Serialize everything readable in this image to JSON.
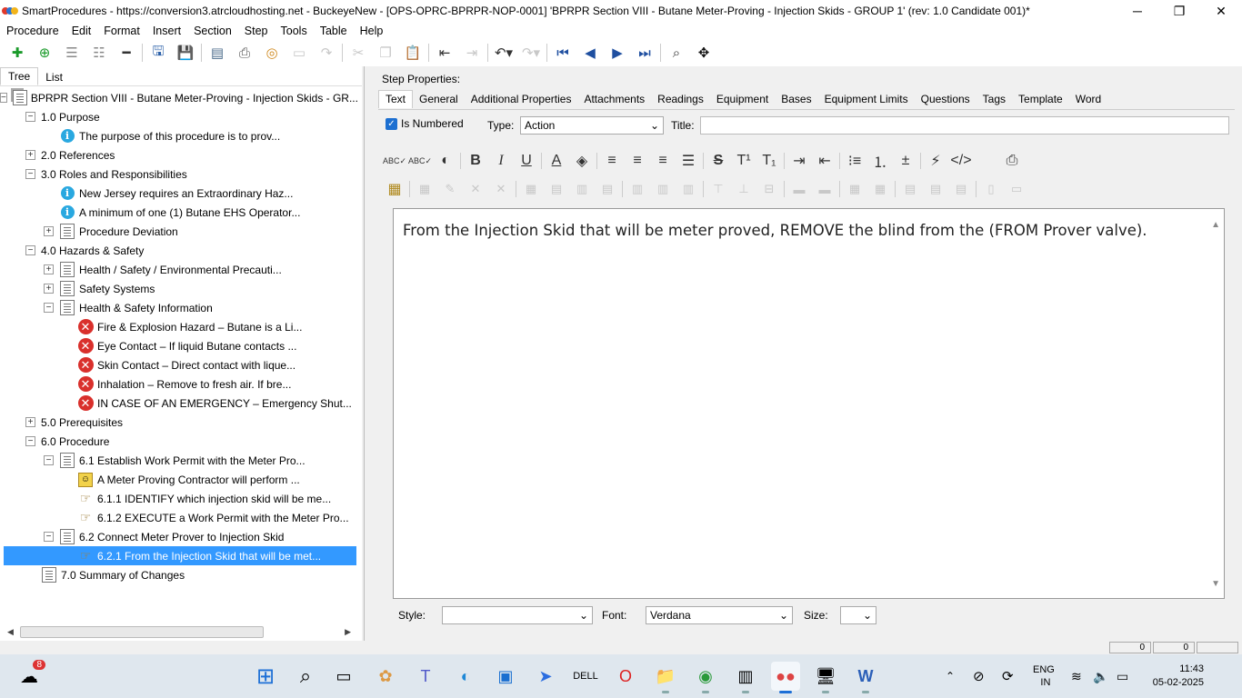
{
  "window": {
    "title": "SmartProcedures - https://conversion3.atrcloudhosting.net - BuckeyeNew - [OPS-OPRC-BPRPR-NOP-0001] 'BPRPR Section VIII - Butane Meter-Proving - Injection Skids - GROUP 1' (rev: 1.0 Candidate 001)*",
    "minimize": "─",
    "restore": "❐",
    "close": "✕"
  },
  "menu": [
    "Procedure",
    "Edit",
    "Format",
    "Insert",
    "Section",
    "Step",
    "Tools",
    "Table",
    "Help"
  ],
  "left_tabs": [
    "Tree",
    "List"
  ],
  "tree": [
    {
      "level": 0,
      "exp": "−",
      "icon": "doc-stack",
      "label": "BPRPR Section VIII - Butane Meter-Proving - Injection Skids - GR..."
    },
    {
      "level": 1,
      "exp": "−",
      "icon": "none",
      "label": "1.0 Purpose"
    },
    {
      "level": 2,
      "exp": "",
      "icon": "info",
      "label": "The purpose of this procedure is to prov..."
    },
    {
      "level": 1,
      "exp": "+",
      "icon": "none",
      "label": "2.0 References"
    },
    {
      "level": 1,
      "exp": "−",
      "icon": "none",
      "label": "3.0 Roles and Responsibilities"
    },
    {
      "level": 2,
      "exp": "",
      "icon": "info",
      "label": "New Jersey requires an Extraordinary Haz..."
    },
    {
      "level": 2,
      "exp": "",
      "icon": "info",
      "label": "A minimum of one (1) Butane EHS Operator..."
    },
    {
      "level": 2,
      "exp": "+",
      "icon": "doc",
      "label": "Procedure Deviation"
    },
    {
      "level": 1,
      "exp": "−",
      "icon": "none",
      "label": "4.0 Hazards & Safety"
    },
    {
      "level": 2,
      "exp": "+",
      "icon": "doc",
      "label": "Health / Safety / Environmental Precauti..."
    },
    {
      "level": 2,
      "exp": "+",
      "icon": "doc",
      "label": "Safety Systems"
    },
    {
      "level": 2,
      "exp": "−",
      "icon": "doc",
      "label": "Health & Safety Information"
    },
    {
      "level": 3,
      "exp": "",
      "icon": "x",
      "label": "Fire & Explosion Hazard – Butane is a Li..."
    },
    {
      "level": 3,
      "exp": "",
      "icon": "x",
      "label": "Eye Contact – If liquid Butane contacts ..."
    },
    {
      "level": 3,
      "exp": "",
      "icon": "x",
      "label": "Skin Contact – Direct contact with lique..."
    },
    {
      "level": 3,
      "exp": "",
      "icon": "x",
      "label": "Inhalation – Remove to fresh air. If bre..."
    },
    {
      "level": 3,
      "exp": "",
      "icon": "x",
      "label": "IN CASE OF AN EMERGENCY – Emergency Shut..."
    },
    {
      "level": 1,
      "exp": "+",
      "icon": "none",
      "label": "5.0 Prerequisites"
    },
    {
      "level": 1,
      "exp": "−",
      "icon": "none",
      "label": "6.0 Procedure"
    },
    {
      "level": 2,
      "exp": "−",
      "icon": "doc",
      "label": "6.1 Establish Work Permit with the Meter Pro..."
    },
    {
      "level": 3,
      "exp": "",
      "icon": "person",
      "label": "A Meter Proving Contractor will perform ..."
    },
    {
      "level": 3,
      "exp": "",
      "icon": "hand",
      "label": "6.1.1 IDENTIFY which injection skid will be me..."
    },
    {
      "level": 3,
      "exp": "",
      "icon": "hand",
      "label": "6.1.2 EXECUTE a Work Permit with the Meter Pro..."
    },
    {
      "level": 2,
      "exp": "−",
      "icon": "doc",
      "label": "6.2 Connect Meter Prover to Injection Skid"
    },
    {
      "level": 3,
      "exp": "",
      "icon": "hand",
      "label": "6.2.1 From the Injection Skid that will be met...",
      "selected": true
    },
    {
      "level": 1,
      "exp": "",
      "icon": "doc",
      "label": "7.0 Summary of Changes"
    }
  ],
  "step_properties": {
    "heading": "Step Properties:",
    "tabs": [
      "Text",
      "General",
      "Additional Properties",
      "Attachments",
      "Readings",
      "Equipment",
      "Bases",
      "Equipment Limits",
      "Questions",
      "Tags",
      "Template",
      "Word"
    ],
    "is_numbered_label": "Is Numbered",
    "type_label": "Type:",
    "type_value": "Action",
    "title_label": "Title:",
    "title_value": "",
    "editor_text": "From the Injection Skid that will be meter proved, REMOVE the blind from the (FROM Prover valve).",
    "style_label": "Style:",
    "style_value": "",
    "font_label": "Font:",
    "font_value": "Verdana",
    "size_label": "Size:",
    "size_value": ""
  },
  "status": {
    "box1": "0",
    "box2": "0"
  },
  "taskbar": {
    "weather_badge": "8",
    "lang_top": "ENG",
    "lang_bottom": "IN",
    "time": "11:43",
    "date": "05-02-2025"
  }
}
